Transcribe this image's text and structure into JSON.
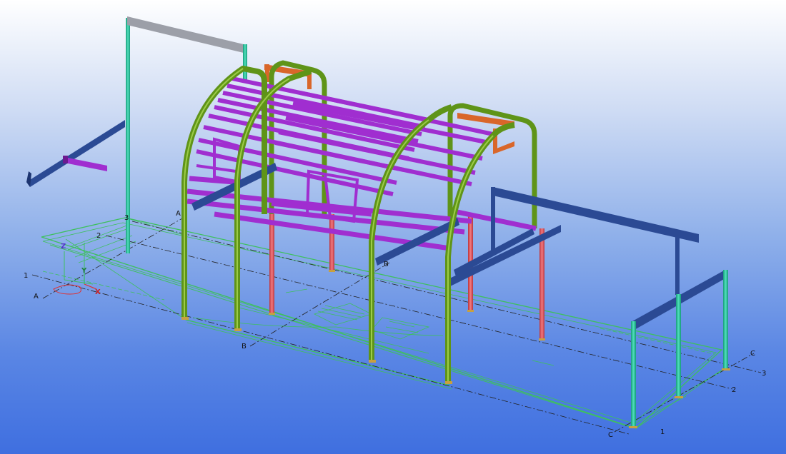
{
  "grid_labels": {
    "a_top": "A",
    "a_left": "A",
    "b_mid": "B",
    "b_bottom": "B",
    "c_right": "C",
    "c_bottom": "C",
    "n1_left": "1",
    "n1_bottom": "1",
    "n2_left": "2",
    "n2_right": "2",
    "n3_top": "3",
    "n3_right": "3"
  },
  "axis_labels": {
    "z": "Z",
    "y": "Y",
    "x": "X"
  },
  "colors": {
    "column_green": "#6c9e1e",
    "purl_magenta": "#a02ed0",
    "post_red": "#e0565e",
    "beam_orange": "#d9662a",
    "column_teal": "#2bbf9a",
    "beam_navy": "#2b4a94",
    "beam_gray": "#9c9fa8",
    "grid_line_green": "#3ec05e"
  },
  "icons": [
    "coordinate-axes-icon"
  ]
}
